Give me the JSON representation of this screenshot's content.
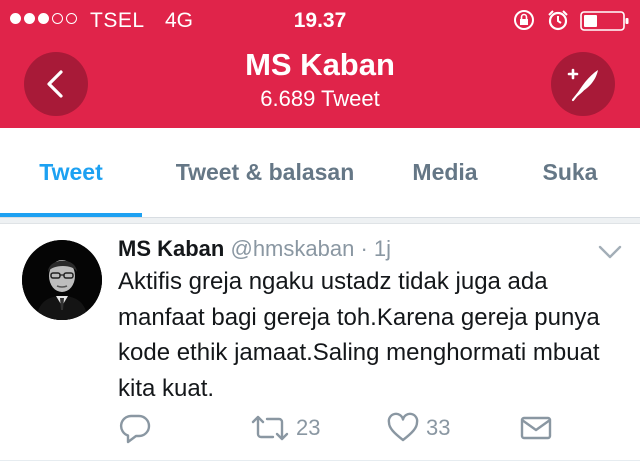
{
  "status_bar": {
    "carrier": "TSEL",
    "network": "4G",
    "time": "19.37",
    "signal_bars_filled": 3,
    "signal_bars_total": 5
  },
  "header": {
    "title": "MS Kaban",
    "subtitle": "6.689 Tweet",
    "background_color": "#e0244a",
    "back_icon": "chevron-left-icon",
    "compose_icon": "compose-tweet-icon"
  },
  "tabs": [
    {
      "label": "Tweet",
      "active": true
    },
    {
      "label": "Tweet & balasan",
      "active": false
    },
    {
      "label": "Media",
      "active": false
    },
    {
      "label": "Suka",
      "active": false
    }
  ],
  "tweet": {
    "name": "MS Kaban",
    "handle": "@hmskaban",
    "separator": "·",
    "time": "1j",
    "text": "Aktifis greja ngaku ustadz tidak juga ada manfaat bagi gereja toh.Karena gereja punya kode ethik jamaat.Saling menghormati mbuat kita kuat.",
    "retweets": "23",
    "likes": "33"
  },
  "colors": {
    "accent": "#1da1f2",
    "muted": "#657786"
  }
}
